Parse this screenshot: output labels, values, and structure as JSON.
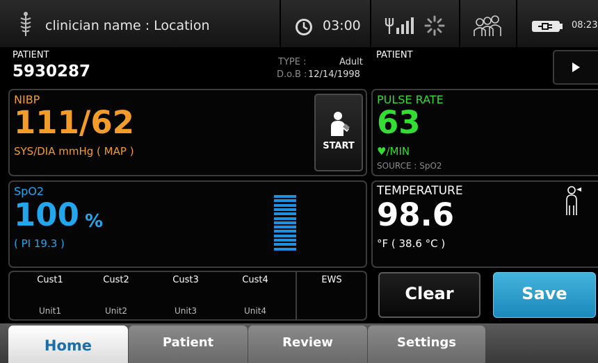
{
  "status_bar": {
    "clinician": "clinician name : Location",
    "clock_value": "03:00",
    "time": "08:23"
  },
  "patient": {
    "label": "PATIENT",
    "id": "5930287",
    "type_label": "TYPE :",
    "type_value": "Adult",
    "dob_label": "D.o.B :",
    "dob_value": "12/14/1998",
    "right_label": "PATIENT"
  },
  "nibp": {
    "name": "NIBP",
    "value": "111/62",
    "units": "SYS/DIA mmHg ( MAP )",
    "start_label": "START"
  },
  "pulse": {
    "name": "PULSE RATE",
    "value": "63",
    "units": "♥/MIN",
    "source": "SOURCE : SpO2"
  },
  "spo2": {
    "name": "SpO2",
    "value": "100",
    "percent": "%",
    "pi": "( PI 19.3 )",
    "signal_bars": 13
  },
  "temperature": {
    "name": "TEMPERATURE",
    "value": "98.6",
    "units": "°F   ( 38.6 °C )"
  },
  "custom": {
    "columns": [
      {
        "name": "Cust1",
        "unit": "Unit1"
      },
      {
        "name": "Cust2",
        "unit": "Unit2"
      },
      {
        "name": "Cust3",
        "unit": "Unit3"
      },
      {
        "name": "Cust4",
        "unit": "Unit4"
      }
    ],
    "ews": "EWS"
  },
  "actions": {
    "clear": "Clear",
    "save": "Save"
  },
  "tabs": {
    "home": "Home",
    "patient": "Patient",
    "review": "Review",
    "settings": "Settings"
  },
  "colors": {
    "nibp": "#f39c2a",
    "pulse": "#33dd33",
    "spo2": "#22a6ee",
    "save": "#2a9ccf",
    "home_tab_text": "#1a6fa8"
  },
  "icons": {
    "clinician": "caduceus-icon",
    "clock": "clock-icon",
    "signal": "antenna-signal-icon",
    "busy": "spinner-icon",
    "people": "people-icon",
    "battery": "battery-plug-icon",
    "play": "play-icon",
    "start": "patient-arm-cuff-icon",
    "temperature": "patient-thermometer-icon"
  }
}
